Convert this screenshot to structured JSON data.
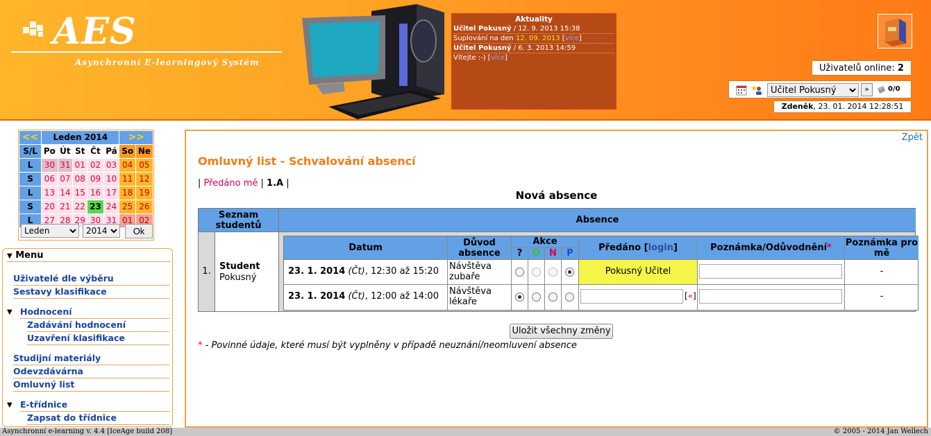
{
  "header": {
    "logo_title": "AES",
    "logo_subtitle": "Asynchronní E-learningový Systém",
    "news": {
      "title": "Aktuality",
      "items": [
        {
          "author": "Učitel Pokusný",
          "date": " / 12. 9. 2013 15:38",
          "text_pre": "Suplování na den ",
          "highlight": "12. 09. 2013",
          "more": "více"
        },
        {
          "author": "Učitel Pokusný",
          "date": " / 6. 3. 2013 14:59",
          "text_pre": "Vítejte :-) ",
          "highlight": "",
          "more": "více"
        }
      ]
    },
    "online_label": "Uživatelů online:",
    "online_count": "2",
    "user_select": "Učitel Pokusný",
    "go_label": "»",
    "messages": "0/0",
    "datetime_name": "Zdeněk",
    "datetime": ", 23. 01. 2014 12:28:51"
  },
  "calendar": {
    "prev": "<<",
    "next": ">>",
    "month": "Leden 2014",
    "headers": [
      "S/L",
      "Po",
      "Út",
      "St",
      "Čt",
      "Pá",
      "So",
      "Ne"
    ],
    "weeks": [
      {
        "wk": "L",
        "days": [
          "30",
          "31",
          "01",
          "02",
          "03",
          "04",
          "05"
        ]
      },
      {
        "wk": "S",
        "days": [
          "06",
          "07",
          "08",
          "09",
          "10",
          "11",
          "12"
        ]
      },
      {
        "wk": "L",
        "days": [
          "13",
          "14",
          "15",
          "16",
          "17",
          "18",
          "19"
        ]
      },
      {
        "wk": "S",
        "days": [
          "20",
          "21",
          "22",
          "23",
          "24",
          "25",
          "26"
        ]
      },
      {
        "wk": "L",
        "days": [
          "27",
          "28",
          "29",
          "30",
          "31",
          "01",
          "02"
        ]
      }
    ],
    "month_select": "Leden",
    "year_select": "2014",
    "ok_label": "Ok"
  },
  "menu": {
    "title": "Menu",
    "items": [
      {
        "label": "Uživatelé dle výběru"
      },
      {
        "label": "Sestavy klasifikace"
      },
      {
        "label": "Hodnocení"
      },
      {
        "label": "Zadávání hodnocení"
      },
      {
        "label": "Uzavření klasifikace"
      },
      {
        "label": "Studijní materiály"
      },
      {
        "label": "Odevzdávárna"
      },
      {
        "label": "Omluvný list"
      },
      {
        "label": "E-třídnice"
      },
      {
        "label": "Zapsat do třídnice"
      }
    ]
  },
  "content": {
    "back": "Zpět",
    "title": "Omluvný list - Schvalování absencí",
    "crumb_sep1": "| ",
    "crumb_link": "Předáno mě",
    "crumb_sep2": " | ",
    "crumb_class": "1.A",
    "crumb_sep3": " |",
    "subtitle": "Nová absence",
    "col_students": "Seznam studentů",
    "col_absence": "Absence",
    "row_num": "1.",
    "student_first": "Student",
    "student_last": "Pokusný",
    "inner_headers": {
      "datum": "Datum",
      "duvod": "Důvod absence",
      "akce": "Akce",
      "akce_q": "?",
      "akce_o": "O",
      "akce_n": "N",
      "akce_p": "P",
      "predano": "Předáno [",
      "login": "login",
      "predano_end": "]",
      "poznamka": "Poznámka/Odůvodnění",
      "req": "*",
      "poznamka_pro_me": "Poznámka pro mě"
    },
    "rows": [
      {
        "date": "23. 1. 2014",
        "day": "(Čt)",
        "time": ", 12:30 až 15:20",
        "reason": "Návštěva zubaře",
        "handed": "Pokusný Učitel",
        "note_me": "-"
      },
      {
        "date": "23. 1. 2014",
        "day": "(Čt)",
        "time": ", 12:00 až 14:00",
        "reason": "Návštěva lékaře",
        "handed": "",
        "insert": "«",
        "note_me": "-"
      }
    ],
    "save_button": "Uložit všechny změny",
    "footnote_star": "*",
    "footnote": " - Povinné údaje, které musí být vyplněny v případě neuznání/neomluvení absence"
  },
  "statusbar": {
    "left": "Asynchronní e-learning  v. 4.4 [IceAge build 208]",
    "right": "© 2005 - 2014  Jan Wellech"
  }
}
